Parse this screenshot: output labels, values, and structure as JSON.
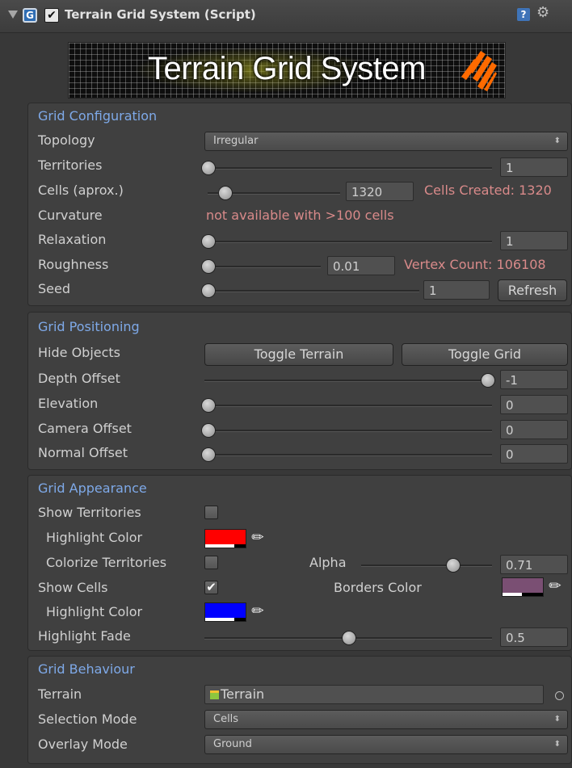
{
  "header": {
    "title": "Terrain Grid System (Script)",
    "enabled": true,
    "enable_glyph": "✔",
    "script_icon_glyph": "G",
    "help_glyph": "?",
    "gear_glyph": "⚙"
  },
  "banner": {
    "title": "Terrain Grid System"
  },
  "configuration": {
    "title": "Grid Configuration",
    "topology": {
      "label": "Topology",
      "value": "Irregular"
    },
    "territories": {
      "label": "Territories",
      "value": "1"
    },
    "cells": {
      "label": "Cells (aprox.)",
      "value": "1320",
      "info": "Cells Created: 1320"
    },
    "curvature": {
      "label": "Curvature",
      "info": "not available with >100 cells"
    },
    "relaxation": {
      "label": "Relaxation",
      "value": "1"
    },
    "roughness": {
      "label": "Roughness",
      "value": "0.01",
      "info": "Vertex Count: 106108"
    },
    "seed": {
      "label": "Seed",
      "value": "1",
      "button": "Refresh"
    }
  },
  "positioning": {
    "title": "Grid Positioning",
    "hide_objects": {
      "label": "Hide Objects",
      "toggle_terrain": "Toggle Terrain",
      "toggle_grid": "Toggle Grid"
    },
    "depth_offset": {
      "label": "Depth Offset",
      "value": "-1"
    },
    "elevation": {
      "label": "Elevation",
      "value": "0"
    },
    "camera_offset": {
      "label": "Camera Offset",
      "value": "0"
    },
    "normal_offset": {
      "label": "Normal Offset",
      "value": "0"
    }
  },
  "appearance": {
    "title": "Grid Appearance",
    "show_territories": {
      "label": "Show Territories",
      "checked": false
    },
    "territory_highlight": {
      "label": "Highlight Color",
      "color": "#ff0000"
    },
    "colorize_territories": {
      "label": "Colorize Territories",
      "checked": false
    },
    "alpha": {
      "label": "Alpha",
      "value": "0.71"
    },
    "show_cells": {
      "label": "Show Cells",
      "checked": true,
      "check_glyph": "✔"
    },
    "borders_color": {
      "label": "Borders Color",
      "color": "#7a4f73"
    },
    "cell_highlight": {
      "label": "Highlight Color",
      "color": "#0000ff"
    },
    "highlight_fade": {
      "label": "Highlight Fade",
      "value": "0.5"
    }
  },
  "behaviour": {
    "title": "Grid Behaviour",
    "terrain": {
      "label": "Terrain",
      "value": "Terrain"
    },
    "selection_mode": {
      "label": "Selection Mode",
      "value": "Cells"
    },
    "overlay_mode": {
      "label": "Overlay Mode",
      "value": "Ground"
    }
  },
  "colors": {
    "accent": "#7ea9e8",
    "warning": "#d98a8a",
    "panel": "#404040"
  }
}
